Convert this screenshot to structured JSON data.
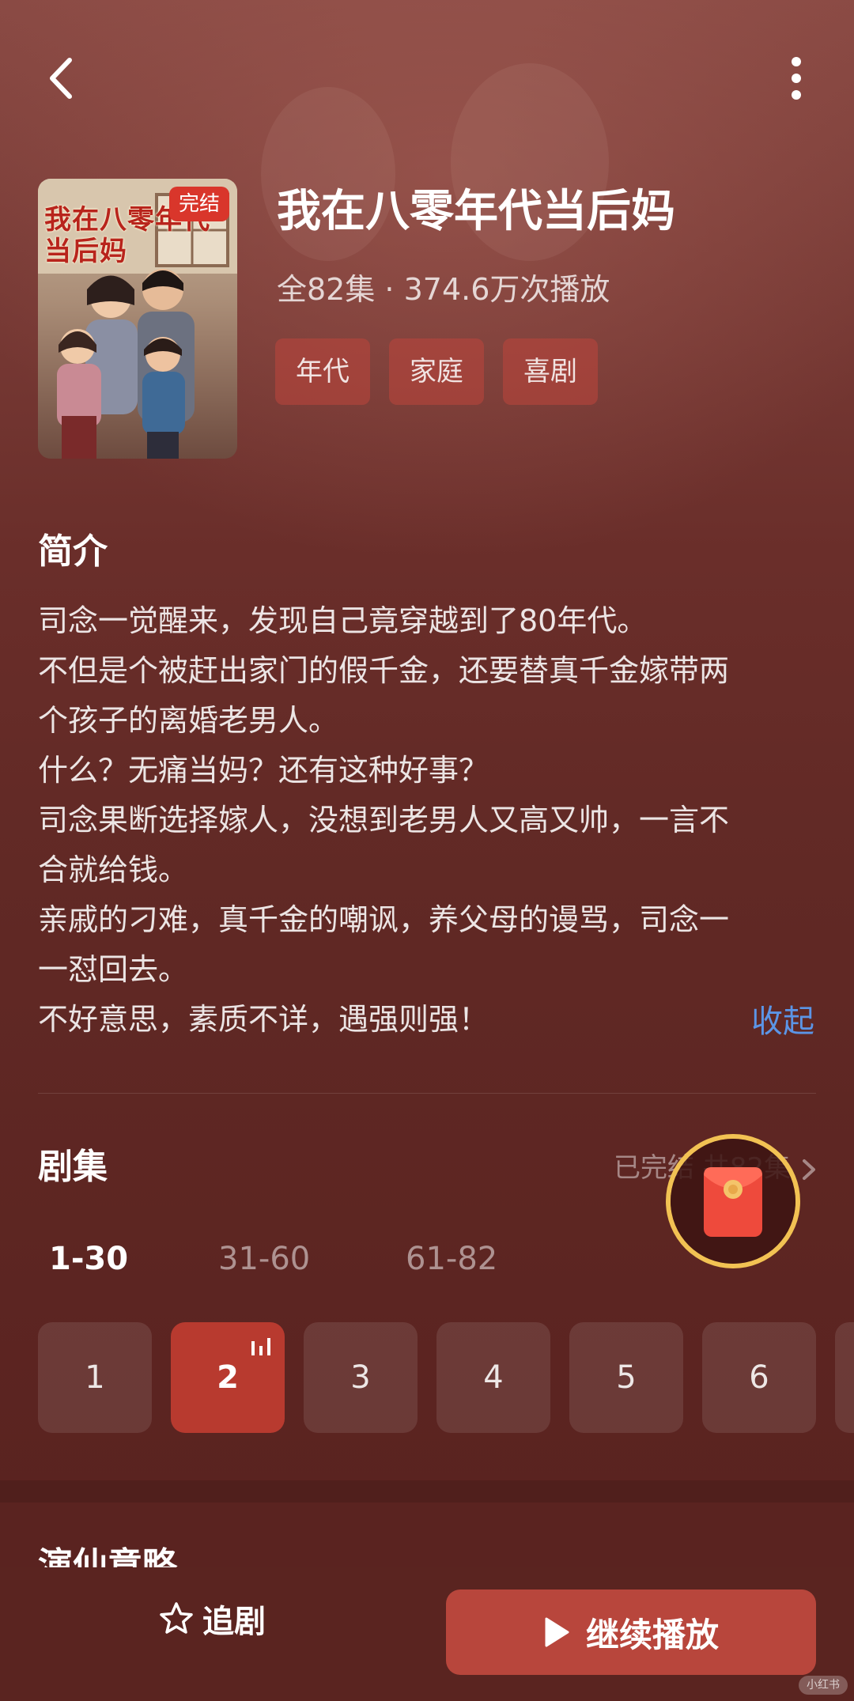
{
  "show": {
    "title": "我在八零年代当后妈",
    "meta": "全82集 · 374.6万次播放",
    "tags": [
      "年代",
      "家庭",
      "喜剧"
    ]
  },
  "poster": {
    "title": "我在八零年代当后妈",
    "badge": "完结"
  },
  "synopsis": {
    "heading": "简介",
    "lines": [
      "司念一觉醒来，发现自己竟穿越到了80年代。",
      "不但是个被赶出家门的假千金，还要替真千金嫁带两",
      "个孩子的离婚老男人。",
      "什么？无痛当妈？还有这种好事？",
      "司念果断选择嫁人，没想到老男人又高又帅，一言不",
      "合就给钱。",
      "亲戚的刁难，真千金的嘲讽，养父母的谩骂，司念一",
      "一怼回去。",
      "不好意思，素质不详，遇强则强！"
    ],
    "collapse_label": "收起"
  },
  "episodes": {
    "heading": "剧集",
    "status": "已完结 共82集",
    "ranges": [
      "1-30",
      "31-60",
      "61-82"
    ],
    "active_range": "1-30",
    "visible": [
      "1",
      "2",
      "3",
      "4",
      "5",
      "6"
    ],
    "current": "2"
  },
  "next_section_title": "演仙意略",
  "actions": {
    "follow_label": "追剧",
    "play_label": "继续播放"
  },
  "colors": {
    "accent": "#b8463c",
    "link": "#5b95e6",
    "ring": "#f2c253"
  },
  "icons": {
    "back": "chevron-left-icon",
    "more": "more-vertical-icon",
    "follow": "star-outline-icon",
    "play": "play-icon",
    "packet": "red-packet-icon",
    "status_arrow": "chevron-right-icon",
    "playing": "equalizer-icon"
  },
  "watermark": "小红书"
}
